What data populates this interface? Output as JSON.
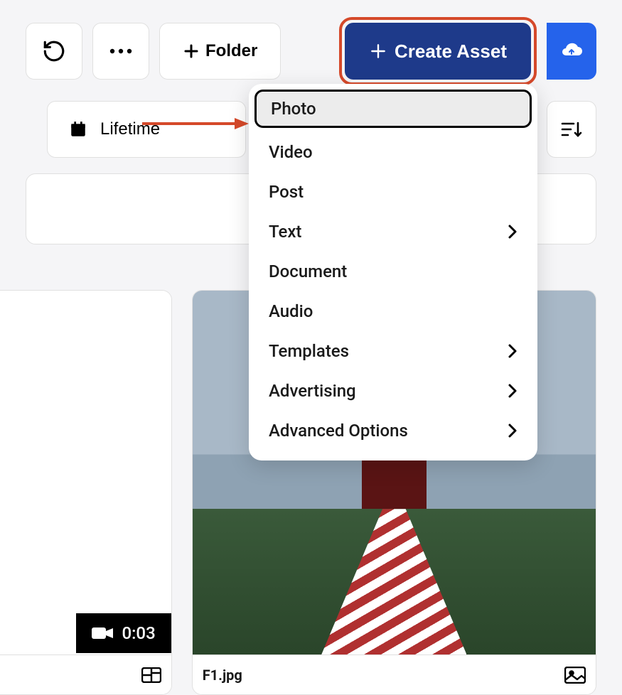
{
  "toolbar": {
    "folder_label": "Folder",
    "create_label": "Create Asset",
    "lifetime_label": "Lifetime"
  },
  "dropdown": {
    "items": [
      {
        "label": "Photo",
        "has_sub": false,
        "highlighted": true
      },
      {
        "label": "Video",
        "has_sub": false
      },
      {
        "label": "Post",
        "has_sub": false
      },
      {
        "label": "Text",
        "has_sub": true
      },
      {
        "label": "Document",
        "has_sub": false
      },
      {
        "label": "Audio",
        "has_sub": false
      },
      {
        "label": "Templates",
        "has_sub": true
      },
      {
        "label": "Advertising",
        "has_sub": true
      },
      {
        "label": "Advanced Options",
        "has_sub": true
      }
    ]
  },
  "cards": {
    "left": {
      "duration": "0:03"
    },
    "right": {
      "filename": "F1.jpg"
    }
  }
}
